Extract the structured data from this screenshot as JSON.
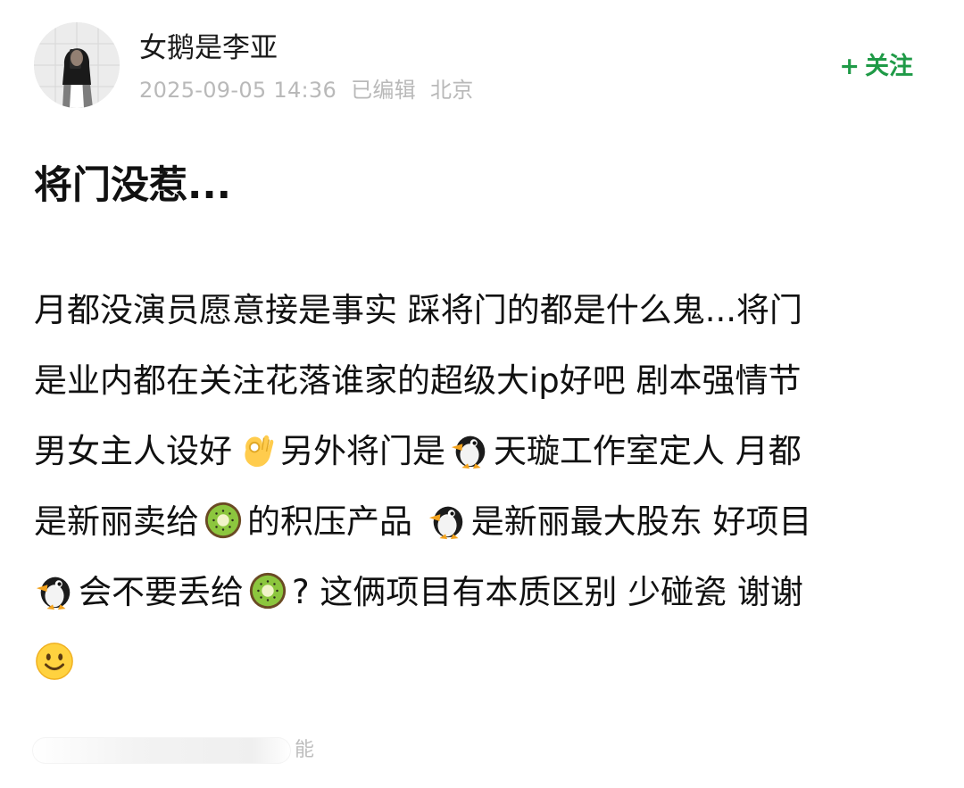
{
  "post": {
    "author": "女鹅是李亚",
    "date": "2025-09-05 14:36",
    "edited": "已编辑",
    "location": "北京",
    "follow_label": "关注",
    "follow_plus": "+",
    "title": "将门没惹...",
    "body_segments": {
      "l1": "月都没演员愿意接是事实 踩将门的都是什么鬼...将门",
      "l2": "是业内都在关注花落谁家的超级大ip好吧 剧本强情节",
      "l3a": "男女主人设好",
      "l3b": "另外将门是",
      "l3c": "天璇工作室定人 月都",
      "l4a": "是新丽卖给",
      "l4b": "的积压产品 ",
      "l4c": "是新丽最大股东 好项目",
      "l5a": "会不要丢给",
      "l5b": "? 这俩项目有本质区别 少碰瓷 谢谢"
    },
    "icons": {
      "ok_hand": "ok-hand-emoji",
      "penguin": "penguin-emoji",
      "kiwi": "kiwi-emoji",
      "smile": "smile-emoji"
    },
    "footer_fragment": "能"
  },
  "colors": {
    "follow": "#1f9a47",
    "meta": "#b9b9b9",
    "text": "#111111"
  }
}
